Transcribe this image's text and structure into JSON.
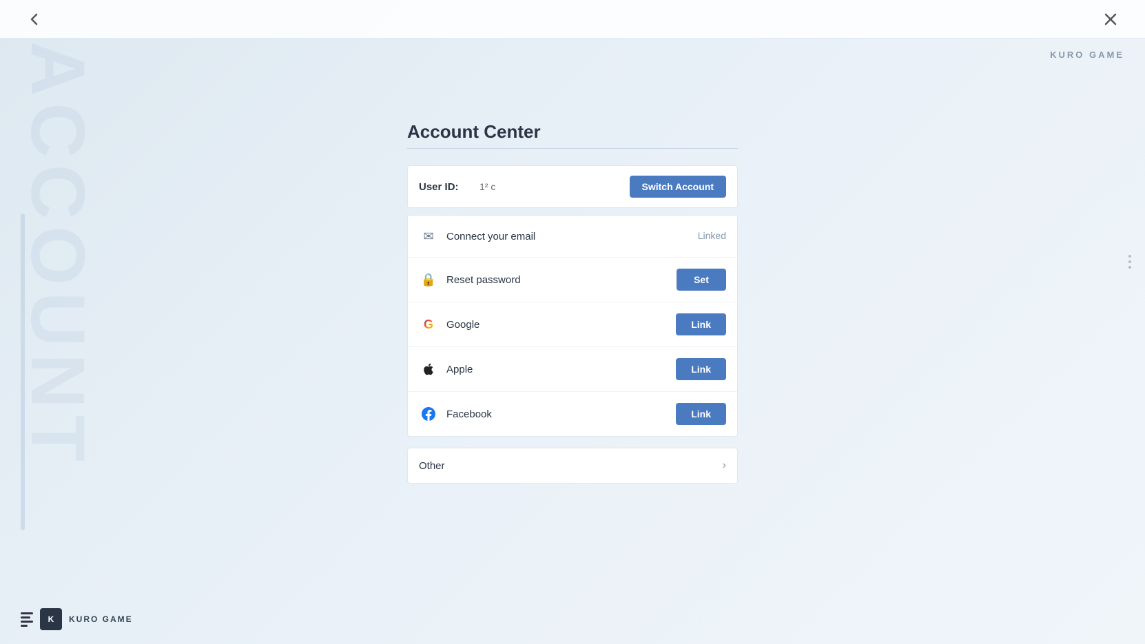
{
  "brand": {
    "name": "KURO GAME",
    "tagline": "ACCOUNT"
  },
  "nav": {
    "back_label": "‹",
    "close_label": "✕"
  },
  "page": {
    "title": "Account Center",
    "divider": true
  },
  "user_id_row": {
    "label": "User ID:",
    "value": "1² c",
    "switch_btn": "Switch Account"
  },
  "account_rows": [
    {
      "id": "email",
      "icon": "✉",
      "icon_name": "email-icon",
      "label": "Connect your email",
      "action_type": "text",
      "action_label": "Linked"
    },
    {
      "id": "password",
      "icon": "🔒",
      "icon_name": "lock-icon",
      "label": "Reset password",
      "action_type": "button",
      "action_label": "Set"
    },
    {
      "id": "google",
      "icon": "G",
      "icon_name": "google-icon",
      "label": "Google",
      "action_type": "button",
      "action_label": "Link"
    },
    {
      "id": "apple",
      "icon": "",
      "icon_name": "apple-icon",
      "label": "Apple",
      "action_type": "button",
      "action_label": "Link"
    },
    {
      "id": "facebook",
      "icon": "f",
      "icon_name": "facebook-icon",
      "label": "Facebook",
      "action_type": "button",
      "action_label": "Link"
    }
  ],
  "other_row": {
    "label": "Other",
    "chevron": "›"
  },
  "watermark": "ACCOUNT",
  "colors": {
    "accent": "#4a7abf",
    "text_primary": "#2a3545",
    "text_secondary": "#8899aa",
    "linked_color": "#8899aa",
    "bg": "#e8f0f7"
  }
}
